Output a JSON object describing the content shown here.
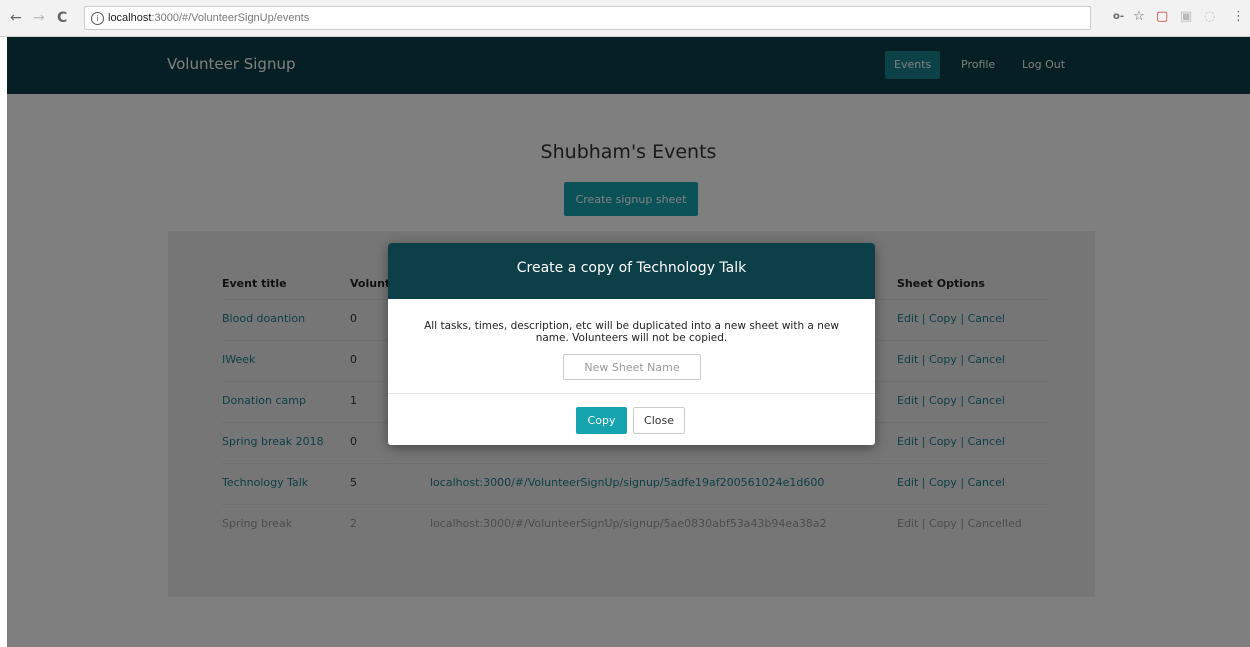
{
  "browser": {
    "back_icon": "←",
    "forward_icon": "→",
    "reload_icon": "C",
    "url_host": "localhost",
    "url_path": ":3000/#/VolunteerSignUp/events",
    "key_icon": "o-",
    "star_icon": "☆",
    "ext1_icon": "▢",
    "ext2_icon": "▣",
    "ext3_icon": "◌",
    "menu_icon": "⋮"
  },
  "navbar": {
    "brand": "Volunteer Signup",
    "links": [
      {
        "label": "Events",
        "active": true
      },
      {
        "label": "Profile",
        "active": false
      },
      {
        "label": "Log Out",
        "active": false
      }
    ]
  },
  "page": {
    "title": "Shubham's Events",
    "create_button": "Create signup sheet"
  },
  "table": {
    "headers": [
      "Event title",
      "Volunt",
      "Sheet Options"
    ],
    "rows": [
      {
        "title": "Blood doantion",
        "volunteers": "0",
        "link": "",
        "edit": "Edit",
        "copy": "Copy",
        "status": "Cancel"
      },
      {
        "title": "IWeek",
        "volunteers": "0",
        "link": "",
        "edit": "Edit",
        "copy": "Copy",
        "status": "Cancel"
      },
      {
        "title": "Donation camp",
        "volunteers": "1",
        "link": "",
        "edit": "Edit",
        "copy": "Copy",
        "status": "Cancel"
      },
      {
        "title": "Spring break 2018",
        "volunteers": "0",
        "link": "",
        "edit": "Edit",
        "copy": "Copy",
        "status": "Cancel"
      },
      {
        "title": "Technology Talk",
        "volunteers": "5",
        "link": "localhost:3000/#/VolunteerSignUp/signup/5adfe19af200561024e1d600",
        "edit": "Edit",
        "copy": "Copy",
        "status": "Cancel"
      },
      {
        "title": "Spring break",
        "volunteers": "2",
        "link": "localhost:3000/#/VolunteerSignUp/signup/5ae0830abf53a43b94ea38a2",
        "edit": "Edit",
        "copy": "Copy",
        "status": "Cancelled"
      }
    ]
  },
  "modal": {
    "title": "Create a copy of Technology Talk",
    "description_line1": "All tasks, times, description, etc will be duplicated into a new sheet with a new",
    "description_line2": "name. Volunteers will not be copied.",
    "input_placeholder": "New Sheet Name",
    "copy_button": "Copy",
    "close_button": "Close"
  },
  "colors": {
    "navbar": "#0d3f48",
    "accent": "#16a3b0",
    "link": "#1b7f8c"
  }
}
